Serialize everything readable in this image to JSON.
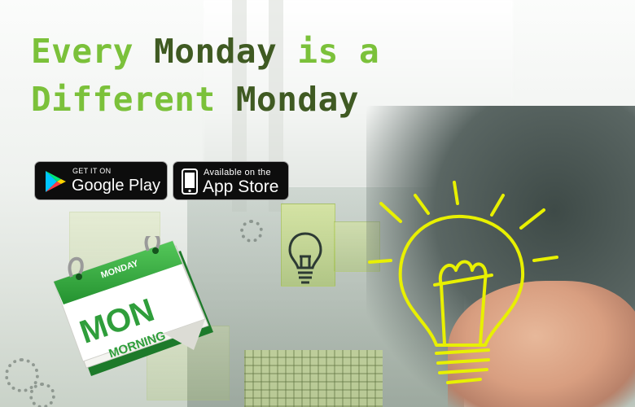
{
  "headline": {
    "line1_part1": "Every ",
    "line1_part2": "Monday",
    "line1_part3": " is a",
    "line2_part1": "Different ",
    "line2_part2": "Monday"
  },
  "badges": {
    "google_play": {
      "small": "GET IT ON",
      "big": "Google Play"
    },
    "app_store": {
      "small": "Available on the",
      "big": "App Store"
    }
  },
  "calendar": {
    "header": "MONDAY",
    "big": "MON",
    "small": "MORNING"
  },
  "colors": {
    "accent_light_green": "#7bc13a",
    "accent_dark_green": "#3f5a22",
    "badge_black": "#0d0d0d",
    "bulb_yellow": "#e8f000",
    "calendar_green": "#2f9e3b"
  },
  "icons": [
    "google-play-icon",
    "apple-icon",
    "lightbulb-icon",
    "calendar-icon"
  ]
}
